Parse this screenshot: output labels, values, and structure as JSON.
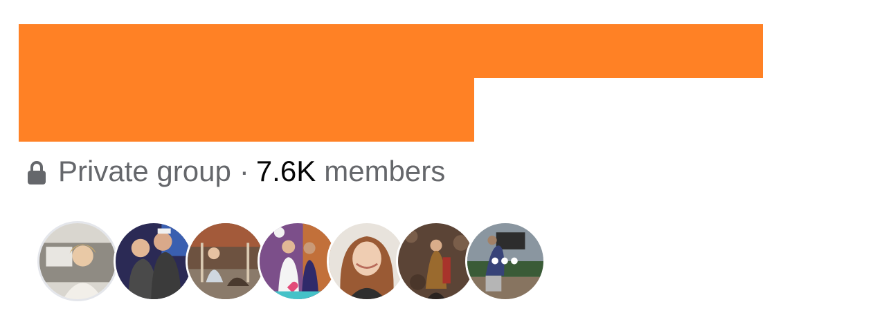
{
  "group": {
    "privacy_label": "Private group",
    "separator": "·",
    "member_count": "7.6K",
    "members_label": "members"
  },
  "icons": {
    "privacy": "lock-icon",
    "more": "more-dots-icon"
  },
  "colors": {
    "redaction": "#FF8125",
    "secondary_text": "#65676B",
    "primary_text": "#050505"
  },
  "more_label": "•••"
}
